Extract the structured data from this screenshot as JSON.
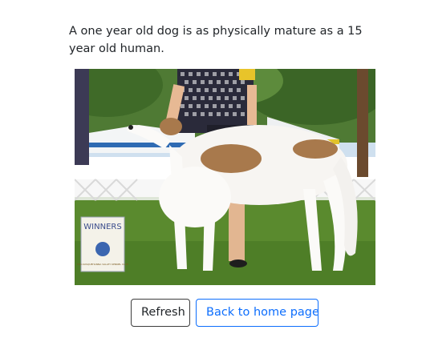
{
  "fact": {
    "text": "A one year old dog is as physically mature as a 15 year old human."
  },
  "photo": {
    "sign_text": "WINNERS",
    "sign_subtext": "MID-SUSQUEHANNA VALLEY KENNEL CLUB"
  },
  "buttons": {
    "refresh_label": "Refresh",
    "home_label": "Back to home page"
  },
  "colors": {
    "primary": "#0d6efd",
    "text": "#212529",
    "grass": "#5a8a2e"
  }
}
